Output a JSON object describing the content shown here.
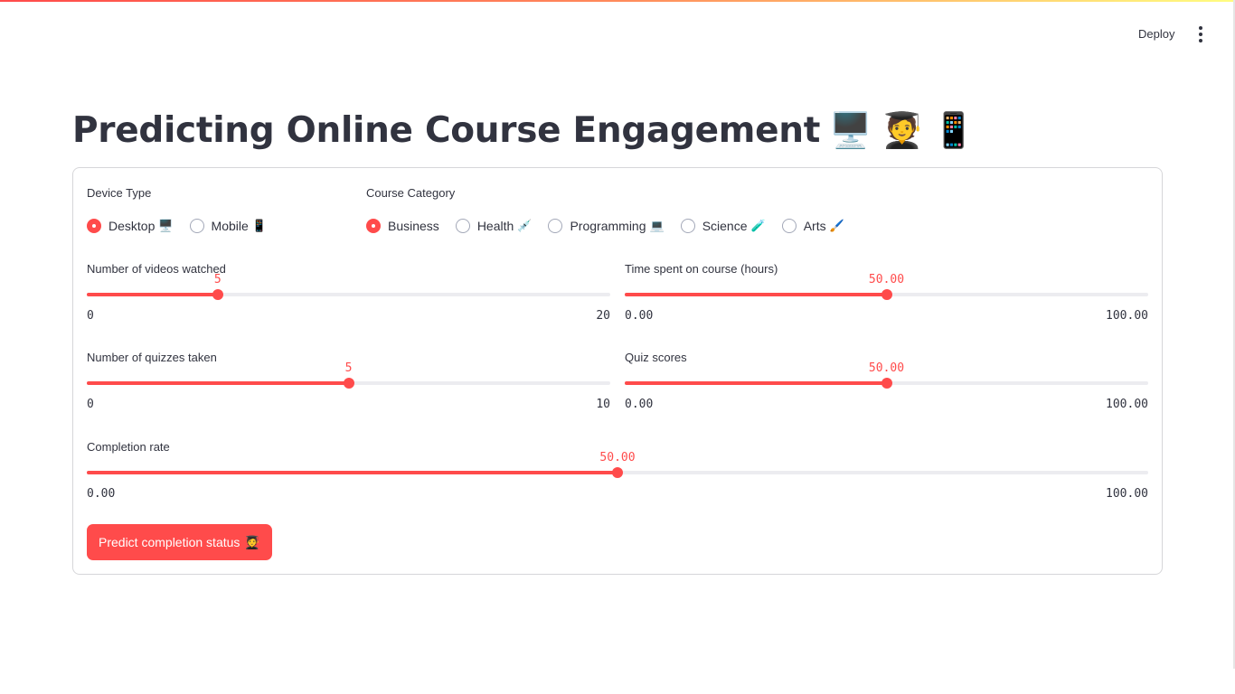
{
  "header": {
    "deploy_label": "Deploy",
    "menu_icon": "vertical-ellipsis-icon"
  },
  "title": {
    "text": "Predicting Online Course Engagement",
    "emojis": [
      "🖥️",
      "🧑‍🎓",
      "📱"
    ]
  },
  "device_type": {
    "label": "Device Type",
    "options": [
      {
        "label": "Desktop",
        "emoji": "🖥️",
        "checked": true
      },
      {
        "label": "Mobile",
        "emoji": "📱",
        "checked": false
      }
    ]
  },
  "course_category": {
    "label": "Course Category",
    "options": [
      {
        "label": "Business",
        "emoji": "",
        "checked": true
      },
      {
        "label": "Health",
        "emoji": "💉",
        "checked": false
      },
      {
        "label": "Programming",
        "emoji": "💻",
        "checked": false
      },
      {
        "label": "Science",
        "emoji": "🧪",
        "checked": false
      },
      {
        "label": "Arts",
        "emoji": "🖌️",
        "checked": false
      }
    ]
  },
  "sliders": {
    "videos": {
      "label": "Number of videos watched",
      "value": 5,
      "min": 0,
      "max": 20,
      "value_text": "5",
      "min_text": "0",
      "max_text": "20"
    },
    "time": {
      "label": "Time spent on course (hours)",
      "value": 50,
      "min": 0,
      "max": 100,
      "value_text": "50.00",
      "min_text": "0.00",
      "max_text": "100.00"
    },
    "quizzes": {
      "label": "Number of quizzes taken",
      "value": 5,
      "min": 0,
      "max": 10,
      "value_text": "5",
      "min_text": "0",
      "max_text": "10"
    },
    "scores": {
      "label": "Quiz scores",
      "value": 50,
      "min": 0,
      "max": 100,
      "value_text": "50.00",
      "min_text": "0.00",
      "max_text": "100.00"
    },
    "completion": {
      "label": "Completion rate",
      "value": 50,
      "min": 0,
      "max": 100,
      "value_text": "50.00",
      "min_text": "0.00",
      "max_text": "100.00"
    }
  },
  "predict_button": {
    "label": "Predict completion status",
    "emoji": "🧑‍🎓"
  },
  "colors": {
    "accent": "#ff4b4b",
    "text": "#31333f",
    "track": "#ececf0"
  }
}
